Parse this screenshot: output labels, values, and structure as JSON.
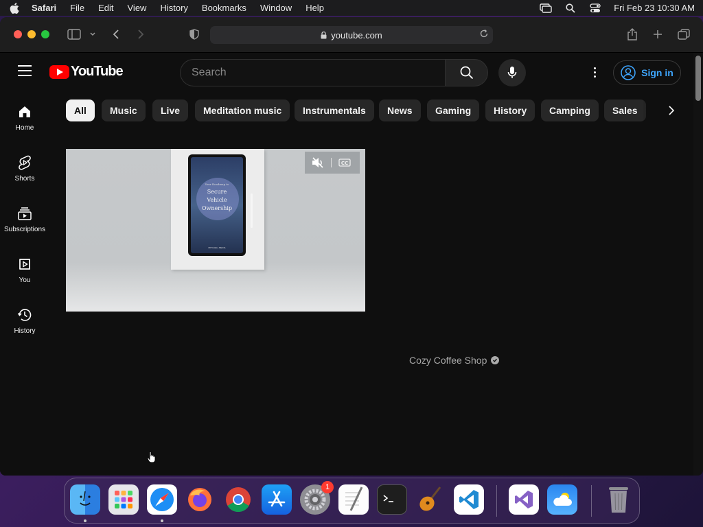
{
  "menubar": {
    "app_name": "Safari",
    "items": [
      "File",
      "Edit",
      "View",
      "History",
      "Bookmarks",
      "Window",
      "Help"
    ],
    "datetime": "Fri Feb 23  10:30 AM"
  },
  "browser": {
    "url": "youtube.com"
  },
  "youtube": {
    "logo_text": "YouTube",
    "search_placeholder": "Search",
    "sign_in_label": "Sign in",
    "guide": [
      {
        "label": "Home",
        "icon": "home-icon"
      },
      {
        "label": "Shorts",
        "icon": "shorts-icon"
      },
      {
        "label": "Subscriptions",
        "icon": "subscriptions-icon"
      },
      {
        "label": "You",
        "icon": "you-icon"
      },
      {
        "label": "History",
        "icon": "history-icon"
      }
    ],
    "chips": [
      "All",
      "Music",
      "Live",
      "Meditation music",
      "Instrumentals",
      "News",
      "Gaming",
      "History",
      "Camping",
      "Sales"
    ],
    "active_chip": "All",
    "video": {
      "tablet_subtitle": "Your Roadmap to",
      "tablet_title_lines": [
        "Secure",
        "Vehicle",
        "Ownership"
      ],
      "tablet_footer": "MITCHELL MEDIA"
    },
    "channel_name": "Cozy Coffee Shop"
  },
  "dock": {
    "apps": [
      "Finder",
      "Launchpad",
      "Safari",
      "Firefox",
      "Chrome",
      "App Store",
      "System Settings",
      "TextEdit",
      "Terminal",
      "GarageBand",
      "Visual Studio Code",
      "Visual Studio",
      "Weather",
      "Trash"
    ],
    "settings_badge": "1"
  },
  "colors": {
    "youtube_red": "#ff0000",
    "signin_blue": "#3ea6ff",
    "page_bg": "#0f0f0f"
  }
}
